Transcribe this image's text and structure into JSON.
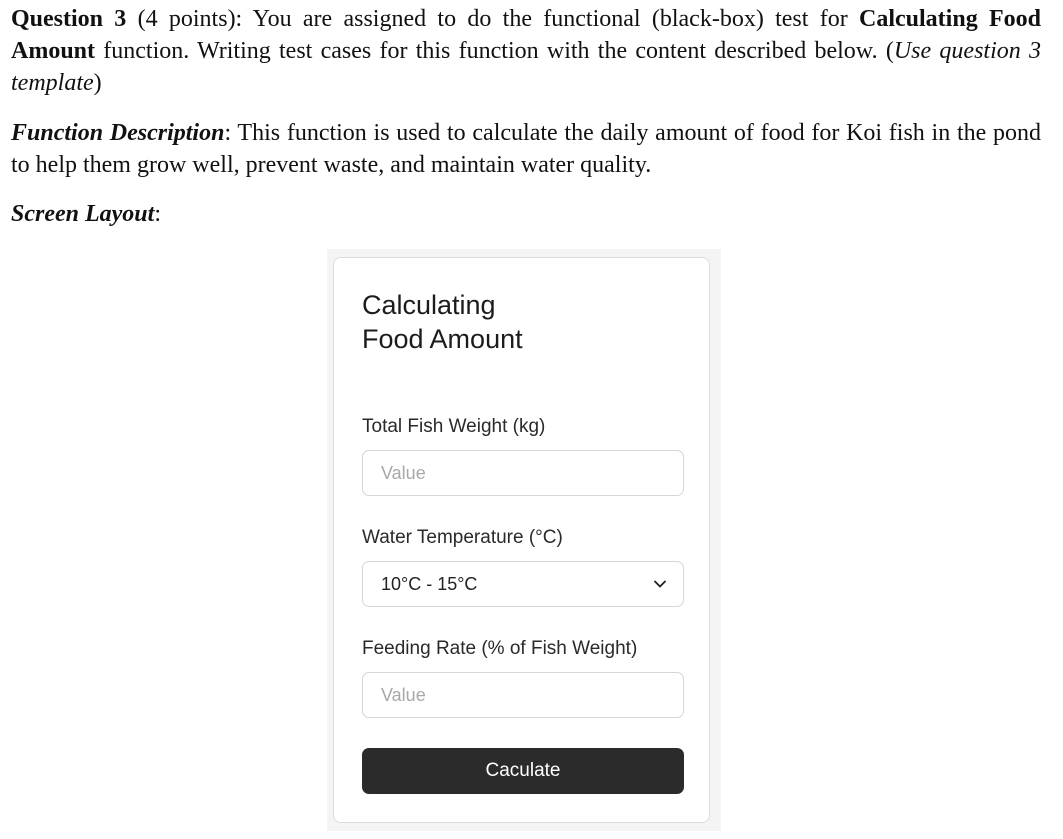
{
  "question": {
    "title": "Question 3",
    "points": " (4 points): You are assigned to do the functional (black-box) test for ",
    "function_name": "Calculating Food Amount",
    "after_name": " function. Writing test cases for this function with the content described below. (",
    "template_note": "Use question 3 template",
    "close_paren": ")"
  },
  "description": {
    "label": "Function Description",
    "text": ": This function is used to calculate the daily amount of food for Koi fish in the pond to help them grow well, prevent waste, and maintain water quality."
  },
  "layout_heading": {
    "label": "Screen Layout",
    "colon": ":"
  },
  "form": {
    "title_line1": "Calculating",
    "title_line2": "Food Amount",
    "weight_label": "Total Fish Weight (kg)",
    "weight_placeholder": "Value",
    "temp_label": "Water Temperature (°C)",
    "temp_selected": "10°C - 15°C",
    "rate_label": "Feeding Rate (% of Fish Weight)",
    "rate_placeholder": "Value",
    "button_label": "Caculate",
    "chevron_icon": "chevron-down-icon"
  }
}
